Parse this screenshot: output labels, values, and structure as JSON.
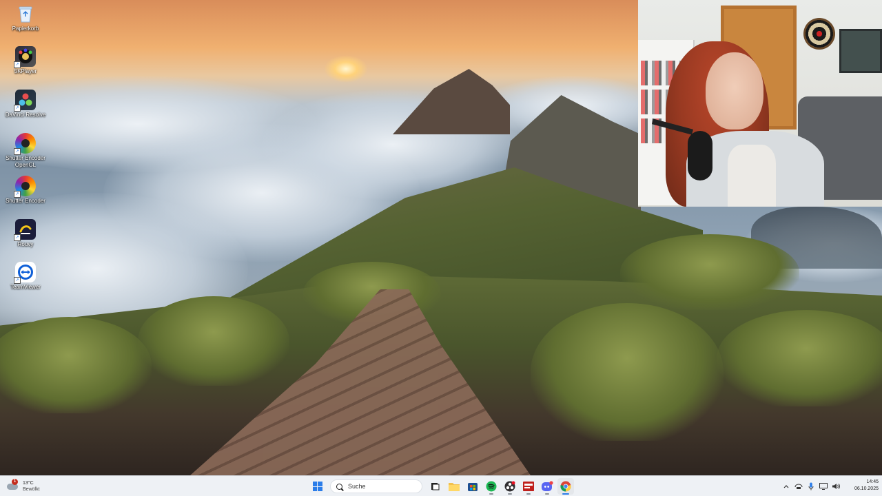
{
  "desktop": {
    "icons": [
      {
        "label": "Papierkorb",
        "icon": "recycle-bin-icon"
      },
      {
        "label": "5KPlayer",
        "icon": "5kplayer-icon"
      },
      {
        "label": "DaVinci Resolve",
        "icon": "davinci-resolve-icon"
      },
      {
        "label": "Shutter Encoder OpenGL",
        "icon": "shutter-encoder-icon"
      },
      {
        "label": "Shutter Encoder",
        "icon": "shutter-encoder-icon"
      },
      {
        "label": "Rouvy",
        "icon": "rouvy-icon"
      },
      {
        "label": "TeamViewer",
        "icon": "teamviewer-icon"
      }
    ]
  },
  "wallpaper": {
    "subject": "mountain-trail-above-clouds"
  },
  "webcam": {
    "visible": true
  },
  "taskbar": {
    "weather": {
      "temperature": "13°C",
      "condition": "Bewölkt",
      "badge": "1"
    },
    "search": {
      "placeholder": "Suche"
    },
    "apps": [
      "start",
      "search",
      "task-view",
      "file-explorer",
      "store",
      "spotify",
      "obs",
      "voicemod",
      "discord",
      "chrome"
    ],
    "tray": [
      "chevron-up",
      "network",
      "microphone",
      "display",
      "volume"
    ],
    "clock": {
      "time": "14:45",
      "date": "06.10.2025"
    }
  },
  "colors": {
    "taskbar_bg": "#eef1f5",
    "accent": "#2b7de9"
  }
}
